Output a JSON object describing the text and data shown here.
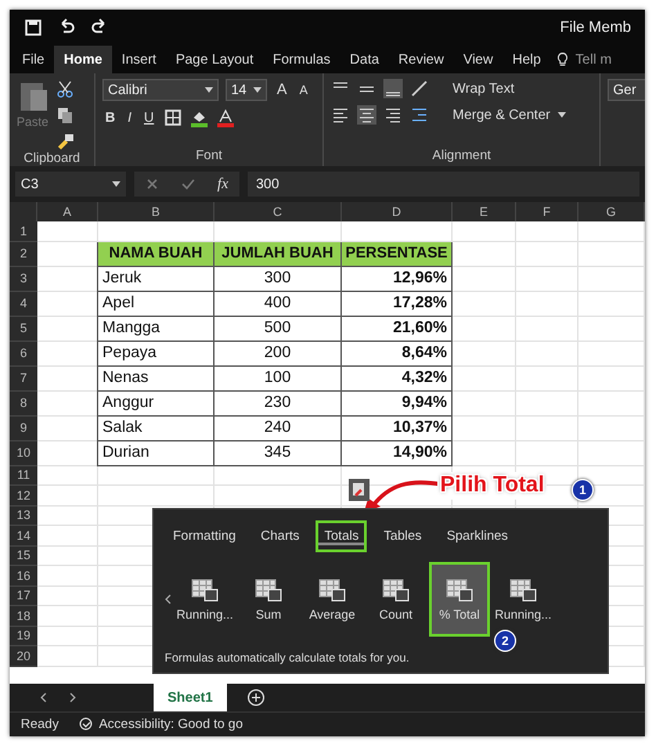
{
  "window": {
    "title": "File Memb"
  },
  "ribbon_tabs": [
    {
      "label": "File",
      "selected": false
    },
    {
      "label": "Home",
      "selected": true
    },
    {
      "label": "Insert",
      "selected": false
    },
    {
      "label": "Page Layout",
      "selected": false
    },
    {
      "label": "Formulas",
      "selected": false
    },
    {
      "label": "Data",
      "selected": false
    },
    {
      "label": "Review",
      "selected": false
    },
    {
      "label": "View",
      "selected": false
    },
    {
      "label": "Help",
      "selected": false
    }
  ],
  "tell_me": "Tell m",
  "clipboard": {
    "paste": "Paste",
    "label": "Clipboard"
  },
  "font": {
    "name": "Calibri",
    "size": "14",
    "grow": "A",
    "shrink": "A",
    "bold": "B",
    "italic": "I",
    "underline": "U",
    "label": "Font"
  },
  "alignment": {
    "wrap": "Wrap Text",
    "merge": "Merge & Center",
    "label": "Alignment"
  },
  "number": {
    "format": "Ger"
  },
  "formula_bar": {
    "name_box": "C3",
    "function": "fx",
    "value": "300"
  },
  "columns": [
    "A",
    "B",
    "C",
    "D",
    "E",
    "F",
    "G"
  ],
  "row_labels": [
    "1",
    "2",
    "3",
    "4",
    "5",
    "6",
    "7",
    "8",
    "9",
    "10",
    "11",
    "12",
    "13",
    "14",
    "15",
    "16",
    "17",
    "18",
    "19",
    "20"
  ],
  "table": {
    "header": [
      "NAMA BUAH",
      "JUMLAH BUAH",
      "PERSENTASE"
    ],
    "rows": [
      [
        "Jeruk",
        "300",
        "12,96%"
      ],
      [
        "Apel",
        "400",
        "17,28%"
      ],
      [
        "Mangga",
        "500",
        "21,60%"
      ],
      [
        "Pepaya",
        "200",
        "8,64%"
      ],
      [
        "Nenas",
        "100",
        "4,32%"
      ],
      [
        "Anggur",
        "230",
        "9,94%"
      ],
      [
        "Salak",
        "240",
        "10,37%"
      ],
      [
        "Durian",
        "345",
        "14,90%"
      ]
    ]
  },
  "callout": {
    "text": "Pilih Total",
    "step": "1"
  },
  "quick_analysis": {
    "tabs": [
      {
        "label": "Formatting",
        "selected": false
      },
      {
        "label": "Charts",
        "selected": false
      },
      {
        "label": "Totals",
        "selected": true
      },
      {
        "label": "Tables",
        "selected": false
      },
      {
        "label": "Sparklines",
        "selected": false
      }
    ],
    "items": [
      {
        "label": "Running...",
        "selected": false
      },
      {
        "label": "Sum",
        "selected": false
      },
      {
        "label": "Average",
        "selected": false
      },
      {
        "label": "Count",
        "selected": false
      },
      {
        "label": "% Total",
        "selected": true
      },
      {
        "label": "Running...",
        "selected": false
      }
    ],
    "step": "2",
    "description": "Formulas automatically calculate totals for you."
  },
  "sheet_tabs": [
    {
      "label": "Sheet1",
      "selected": true
    }
  ],
  "status_bar": {
    "ready": "Ready",
    "accessibility": "Accessibility: Good to go"
  }
}
